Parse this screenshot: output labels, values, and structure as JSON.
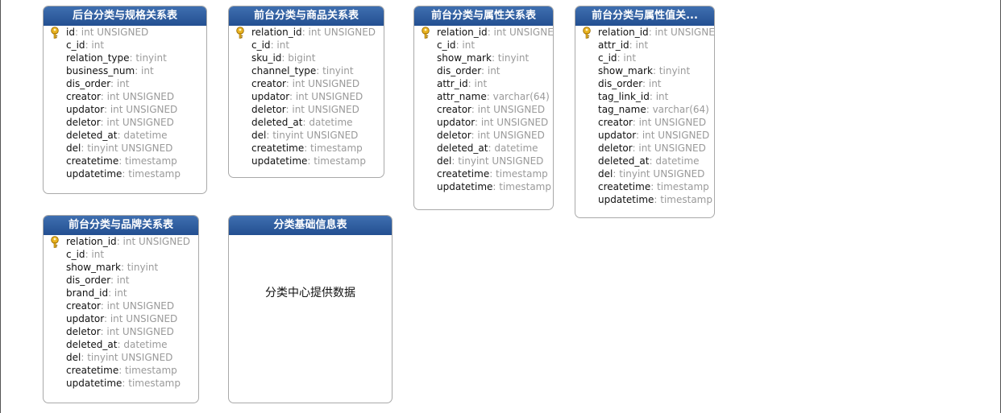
{
  "colors": {
    "header_start": "#3f6fb0",
    "header_end": "#234f91",
    "key_icon": "#e8b21f",
    "type_text": "#9a9a9a",
    "frame": "#555555"
  },
  "entities": [
    {
      "title": "后台分类与规格关系表",
      "fields": [
        {
          "name": "id",
          "type": ": int UNSIGNED",
          "pk": true
        },
        {
          "name": "c_id",
          "type": ": int"
        },
        {
          "name": "relation_type",
          "type": ": tinyint"
        },
        {
          "name": "business_num",
          "type": ": int"
        },
        {
          "name": "dis_order",
          "type": ": int"
        },
        {
          "name": "creator",
          "type": ": int UNSIGNED"
        },
        {
          "name": "updator",
          "type": ": int UNSIGNED"
        },
        {
          "name": "deletor",
          "type": ": int UNSIGNED"
        },
        {
          "name": "deleted_at",
          "type": ": datetime"
        },
        {
          "name": "del",
          "type": ": tinyint UNSIGNED"
        },
        {
          "name": "createtime",
          "type": ": timestamp"
        },
        {
          "name": "updatetime",
          "type": ": timestamp"
        }
      ]
    },
    {
      "title": "前台分类与商品关系表",
      "fields": [
        {
          "name": "relation_id",
          "type": ": int UNSIGNED",
          "pk": true
        },
        {
          "name": "c_id",
          "type": ": int"
        },
        {
          "name": "sku_id",
          "type": ": bigint"
        },
        {
          "name": "channel_type",
          "type": ": tinyint"
        },
        {
          "name": "creator",
          "type": ": int UNSIGNED"
        },
        {
          "name": "updator",
          "type": ": int UNSIGNED"
        },
        {
          "name": "deletor",
          "type": ": int UNSIGNED"
        },
        {
          "name": "deleted_at",
          "type": ": datetime"
        },
        {
          "name": "del",
          "type": ": tinyint UNSIGNED"
        },
        {
          "name": "createtime",
          "type": ": timestamp"
        },
        {
          "name": "updatetime",
          "type": ": timestamp"
        }
      ]
    },
    {
      "title": "前台分类与属性关系表",
      "fields": [
        {
          "name": "relation_id",
          "type": ": int UNSIGNED",
          "pk": true
        },
        {
          "name": "c_id",
          "type": ": int"
        },
        {
          "name": "show_mark",
          "type": ": tinyint"
        },
        {
          "name": "dis_order",
          "type": ": int"
        },
        {
          "name": "attr_id",
          "type": ": int"
        },
        {
          "name": "attr_name",
          "type": ": varchar(64)"
        },
        {
          "name": "creator",
          "type": ": int UNSIGNED"
        },
        {
          "name": "updator",
          "type": ": int UNSIGNED"
        },
        {
          "name": "deletor",
          "type": ": int UNSIGNED"
        },
        {
          "name": "deleted_at",
          "type": ": datetime"
        },
        {
          "name": "del",
          "type": ": tinyint UNSIGNED"
        },
        {
          "name": "createtime",
          "type": ": timestamp"
        },
        {
          "name": "updatetime",
          "type": ": timestamp"
        }
      ]
    },
    {
      "title": "前台分类与属性值关...",
      "fields": [
        {
          "name": "relation_id",
          "type": ": int UNSIGNED",
          "pk": true
        },
        {
          "name": "attr_id",
          "type": ": int"
        },
        {
          "name": "c_id",
          "type": ": int"
        },
        {
          "name": "show_mark",
          "type": ": tinyint"
        },
        {
          "name": "dis_order",
          "type": ": int"
        },
        {
          "name": "tag_link_id",
          "type": ": int"
        },
        {
          "name": "tag_name",
          "type": ": varchar(64)"
        },
        {
          "name": "creator",
          "type": ": int UNSIGNED"
        },
        {
          "name": "updator",
          "type": ": int UNSIGNED"
        },
        {
          "name": "deletor",
          "type": ": int UNSIGNED"
        },
        {
          "name": "deleted_at",
          "type": ": datetime"
        },
        {
          "name": "del",
          "type": ": tinyint UNSIGNED"
        },
        {
          "name": "createtime",
          "type": ": timestamp"
        },
        {
          "name": "updatetime",
          "type": ": timestamp"
        }
      ]
    },
    {
      "title": "前台分类与品牌关系表",
      "fields": [
        {
          "name": "relation_id",
          "type": ": int UNSIGNED",
          "pk": true
        },
        {
          "name": "c_id",
          "type": ": int"
        },
        {
          "name": "show_mark",
          "type": ": tinyint"
        },
        {
          "name": "dis_order",
          "type": ": int"
        },
        {
          "name": "brand_id",
          "type": ": int"
        },
        {
          "name": "creator",
          "type": ": int UNSIGNED"
        },
        {
          "name": "updator",
          "type": ": int UNSIGNED"
        },
        {
          "name": "deletor",
          "type": ": int UNSIGNED"
        },
        {
          "name": "deleted_at",
          "type": ": datetime"
        },
        {
          "name": "del",
          "type": ": tinyint UNSIGNED"
        },
        {
          "name": "createtime",
          "type": ": timestamp"
        },
        {
          "name": "updatetime",
          "type": ": timestamp"
        }
      ]
    },
    {
      "title": "分类基础信息表",
      "note": "分类中心提供数据",
      "fields": []
    }
  ]
}
